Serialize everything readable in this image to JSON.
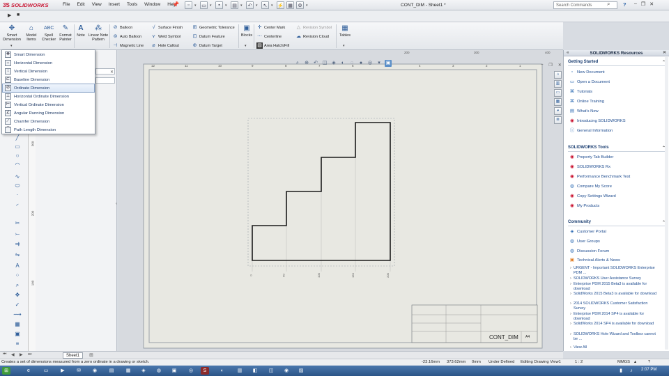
{
  "app": {
    "brand": "SOLIDWORKS",
    "brand_prefix": "3S",
    "document_title": "CONT_DIM - Sheet1 *",
    "search_placeholder": "Search Commands"
  },
  "menu": [
    "File",
    "Edit",
    "View",
    "Insert",
    "Tools",
    "Window",
    "Help"
  ],
  "ribbon": {
    "big_buttons": [
      {
        "label": "Smart\nDimension",
        "icon": "smart-dimension-icon"
      },
      {
        "label": "Model\nItems",
        "icon": "model-items-icon"
      },
      {
        "label": "Spell\nChecker",
        "icon": "spell-checker-icon"
      },
      {
        "label": "Format\nPainter",
        "icon": "format-painter-icon"
      },
      {
        "label": "Note",
        "icon": "note-icon"
      },
      {
        "label": "Linear Note\nPattern",
        "icon": "linear-note-pattern-icon"
      }
    ],
    "col1": [
      "Balloon",
      "Auto Balloon",
      "Magnetic Line"
    ],
    "col2": [
      "Surface Finish",
      "Weld Symbol",
      "Hole Callout"
    ],
    "col3": [
      "Geometric Tolerance",
      "Datum Feature",
      "Datum Target"
    ],
    "blocks": "Blocks",
    "col4": [
      "Center Mark",
      "Centerline",
      "Area Hatch/Fill"
    ],
    "col5": [
      "Revision Symbol",
      "Revision Cloud"
    ],
    "tables": "Tables"
  },
  "dropdown": {
    "items": [
      "Smart Dimension",
      "Horizontal Dimension",
      "Vertical Dimension",
      "Baseline Dimension",
      "Ordinate Dimension",
      "Horizontal Ordinate Dimension",
      "Vertical Ordinate Dimension",
      "Angular Running Dimension",
      "Chamfer Dimension",
      "Path Length Dimension"
    ],
    "selected_index": 4
  },
  "rulers": {
    "top": [
      "12",
      "11",
      "10",
      "9",
      "8",
      "7",
      "6",
      "5",
      "4",
      "3",
      "2",
      "1"
    ],
    "left": [
      "300",
      "200",
      "100"
    ],
    "top_right": [
      "200",
      "300",
      "400"
    ]
  },
  "drawing": {
    "ordinate_labels": [
      "0",
      "50",
      "100",
      "150",
      "200"
    ],
    "title_block_name": "CONT_DIM",
    "sheet_size": "A4"
  },
  "resources": {
    "title": "SOLIDWORKS Resources",
    "getting_started": {
      "heading": "Getting Started",
      "items": [
        "New Document",
        "Open a Document",
        "Tutorials",
        "Online Training",
        "What's New",
        "Introducing SOLIDWORKS",
        "General Information"
      ]
    },
    "tools": {
      "heading": "SOLIDWORKS Tools",
      "items": [
        "Property Tab Builder",
        "SOLIDWORKS Rx",
        "Performance Benchmark Test",
        "Compare My Score",
        "Copy Settings Wizard",
        "My Products"
      ]
    },
    "community": {
      "heading": "Community",
      "items": [
        "Customer Portal",
        "User Groups",
        "Discussion Forum",
        "Technical Alerts & News"
      ],
      "news": [
        "URGENT - Important SOLIDWORKS Enterprise PDM ...",
        "SOLIDWORKS User Assistance Survey",
        "Enterprise PDM 2015 Beta3 is available for download",
        "SolidWorks 2015 Beta3 is available for download",
        "2014 SOLIDWORKS Customer Satisfaction Survey",
        "Enterprise PDM 2014 SP4 is available for download",
        "SolidWorks 2014 SP4 is available for download",
        "SOLIDWORKS Hole Wizard and Toolbox cannot be ..."
      ],
      "view_all": "View All"
    }
  },
  "sheet": {
    "tab": "Sheet1"
  },
  "status": {
    "message": "Creates a set of dimensions measured from a zero ordinate in a drawing or sketch.",
    "x": "-23.16mm",
    "y": "373.62mm",
    "z": "0mm",
    "state": "Under Defined",
    "mode": "Editing Drawing View1",
    "scale": "1 : 2",
    "units": "MMGS",
    "clock": "2:07 PM"
  }
}
